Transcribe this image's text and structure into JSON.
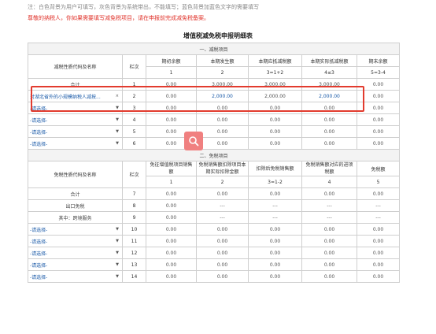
{
  "notes": {
    "note1": "注：白色背景为用户可填写，灰色背景为系统带出，不能填写；蓝色背景加蓝色文字的需要填写",
    "note2": "尊敬的纳税人，你如果需要填写减免税项目，请在申报前完成减免税备案。"
  },
  "table_title": "增值税减免税申报明细表",
  "section1": {
    "title": "一、减税项目",
    "headers": [
      "减税性质代码及名称",
      "栏次",
      "期初余额",
      "本期发生额",
      "本期应抵减税额",
      "本期实际抵减税额",
      "期末余额"
    ],
    "subheaders": [
      "1",
      "2",
      "3=1+2",
      "4≤3",
      "5=3-4"
    ],
    "rows": [
      {
        "name": "合计",
        "line": "1",
        "c1": "0.00",
        "c2": "3,000.00",
        "c3": "3,000.00",
        "c4": "3,000.00",
        "c5": "0.00"
      },
      {
        "name": "对湖北省外的小规模纳税人减按...",
        "line": "2",
        "c1": "0.00",
        "c2": "2,000.00",
        "c3": "2,000.00",
        "c4": "2,000.00",
        "c5": "0.00"
      },
      {
        "name": "-请选择-",
        "line": "3",
        "c1": "0.00",
        "c2": "0.00",
        "c3": "0.00",
        "c4": "0.00",
        "c5": "0.00"
      },
      {
        "name": "-请选择-",
        "line": "4",
        "c1": "0.00",
        "c2": "0.00",
        "c3": "0.00",
        "c4": "0.00",
        "c5": "0.00"
      },
      {
        "name": "-请选择-",
        "line": "5",
        "c1": "0.00",
        "c2": "0.00",
        "c3": "0.00",
        "c4": "0.00",
        "c5": "0.00"
      },
      {
        "name": "-请选择-",
        "line": "6",
        "c1": "0.00",
        "c2": "0.00",
        "c3": "0.00",
        "c4": "0.00",
        "c5": "0.00"
      }
    ]
  },
  "section2": {
    "title": "二、免税项目",
    "headers": [
      "免税性质代码及名称",
      "栏次",
      "免征增值税项目销售额",
      "免税销售额扣除项目本期实际扣除金额",
      "扣除后免税销售额",
      "免税销售额对应的进项税额",
      "免税额"
    ],
    "subheaders": [
      "1",
      "2",
      "3=1-2",
      "4",
      "5"
    ],
    "rows": [
      {
        "name": "合计",
        "line": "7",
        "c1": "0.00",
        "c2": "0.00",
        "c3": "0.00",
        "c4": "0.00",
        "c5": "0.00"
      },
      {
        "name": "出口免税",
        "line": "8",
        "c1": "0.00",
        "c2": "---",
        "c3": "---",
        "c4": "---",
        "c5": "---"
      },
      {
        "name": "其中：跨境服务",
        "line": "9",
        "c1": "0.00",
        "c2": "---",
        "c3": "---",
        "c4": "---",
        "c5": "---"
      },
      {
        "name": "-请选择-",
        "line": "10",
        "c1": "0.00",
        "c2": "0.00",
        "c3": "0.00",
        "c4": "0.00",
        "c5": "0.00"
      },
      {
        "name": "-请选择-",
        "line": "11",
        "c1": "0.00",
        "c2": "0.00",
        "c3": "0.00",
        "c4": "0.00",
        "c5": "0.00"
      },
      {
        "name": "-请选择-",
        "line": "12",
        "c1": "0.00",
        "c2": "0.00",
        "c3": "0.00",
        "c4": "0.00",
        "c5": "0.00"
      },
      {
        "name": "-请选择-",
        "line": "13",
        "c1": "0.00",
        "c2": "0.00",
        "c3": "0.00",
        "c4": "0.00",
        "c5": "0.00"
      },
      {
        "name": "-请选择-",
        "line": "14",
        "c1": "0.00",
        "c2": "0.00",
        "c3": "0.00",
        "c4": "0.00",
        "c5": "0.00"
      }
    ]
  },
  "clear_symbol": "×",
  "dropdown_arrow": "▼",
  "colors": {
    "highlight": "#e23b2e",
    "blue_text": "#1a5aa8",
    "warning": "#e0332b"
  },
  "icons": {
    "zoom": "zoom-magnifier-icon",
    "dropdown": "dropdown-arrow-icon",
    "clear": "clear-icon"
  }
}
